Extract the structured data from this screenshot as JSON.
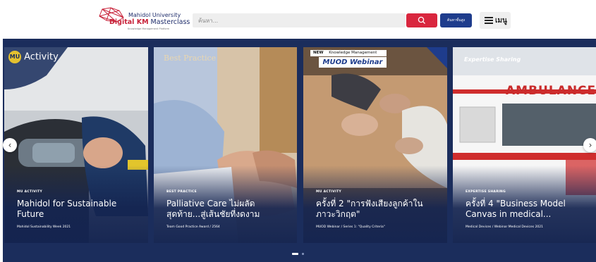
{
  "header": {
    "logo_line1": "Mahidol University",
    "logo_line2a": "Digital KM",
    "logo_line2b": " Masterclass",
    "logo_line3": "Knowledge Management Platform",
    "search_placeholder": "ค้นหา...",
    "advanced_label": "ค้นหาขั้นสูง",
    "menu_label": "เมนู"
  },
  "cards": [
    {
      "badge": "Activity",
      "category": "MU ACTIVITY",
      "title": "Mahidol for Sustainable Future",
      "meta": "Mahidol Sustainability Week 2021"
    },
    {
      "badge": "Best Practice",
      "category": "BEST PRACTICE",
      "title": "Palliative Care ไม่ผลัดสุดท้าย...สู่เส้นชัยที่งดงาม",
      "meta": "Team Good Practice Award / 2564"
    },
    {
      "badge": "MUOD Webinar",
      "badge_small": "Knowledge Management",
      "category": "MU ACTIVITY",
      "title": "ครั้งที่ 2 \"การฟังเสียงลูกค้าในภาวะวิกฤต\"",
      "meta": "MUOD Webinar / Series 1: \"Quality Criteria\""
    },
    {
      "badge": "Expertise Sharing",
      "category": "EXPERTISE SHARING",
      "title": "ครั้งที่ 4 \"Business Model Canvas in medical...",
      "meta": "Medical Devices / Webinar Medical Devices 2021",
      "vehicle_text": "AMBULANCE"
    }
  ],
  "carousel": {
    "prev": "‹",
    "next": "›",
    "slide_count": 2,
    "active_slide": 1
  },
  "colors": {
    "brand_red": "#d9263e",
    "brand_blue": "#1e3c8c",
    "banner_bg": "#1b2d5c"
  }
}
